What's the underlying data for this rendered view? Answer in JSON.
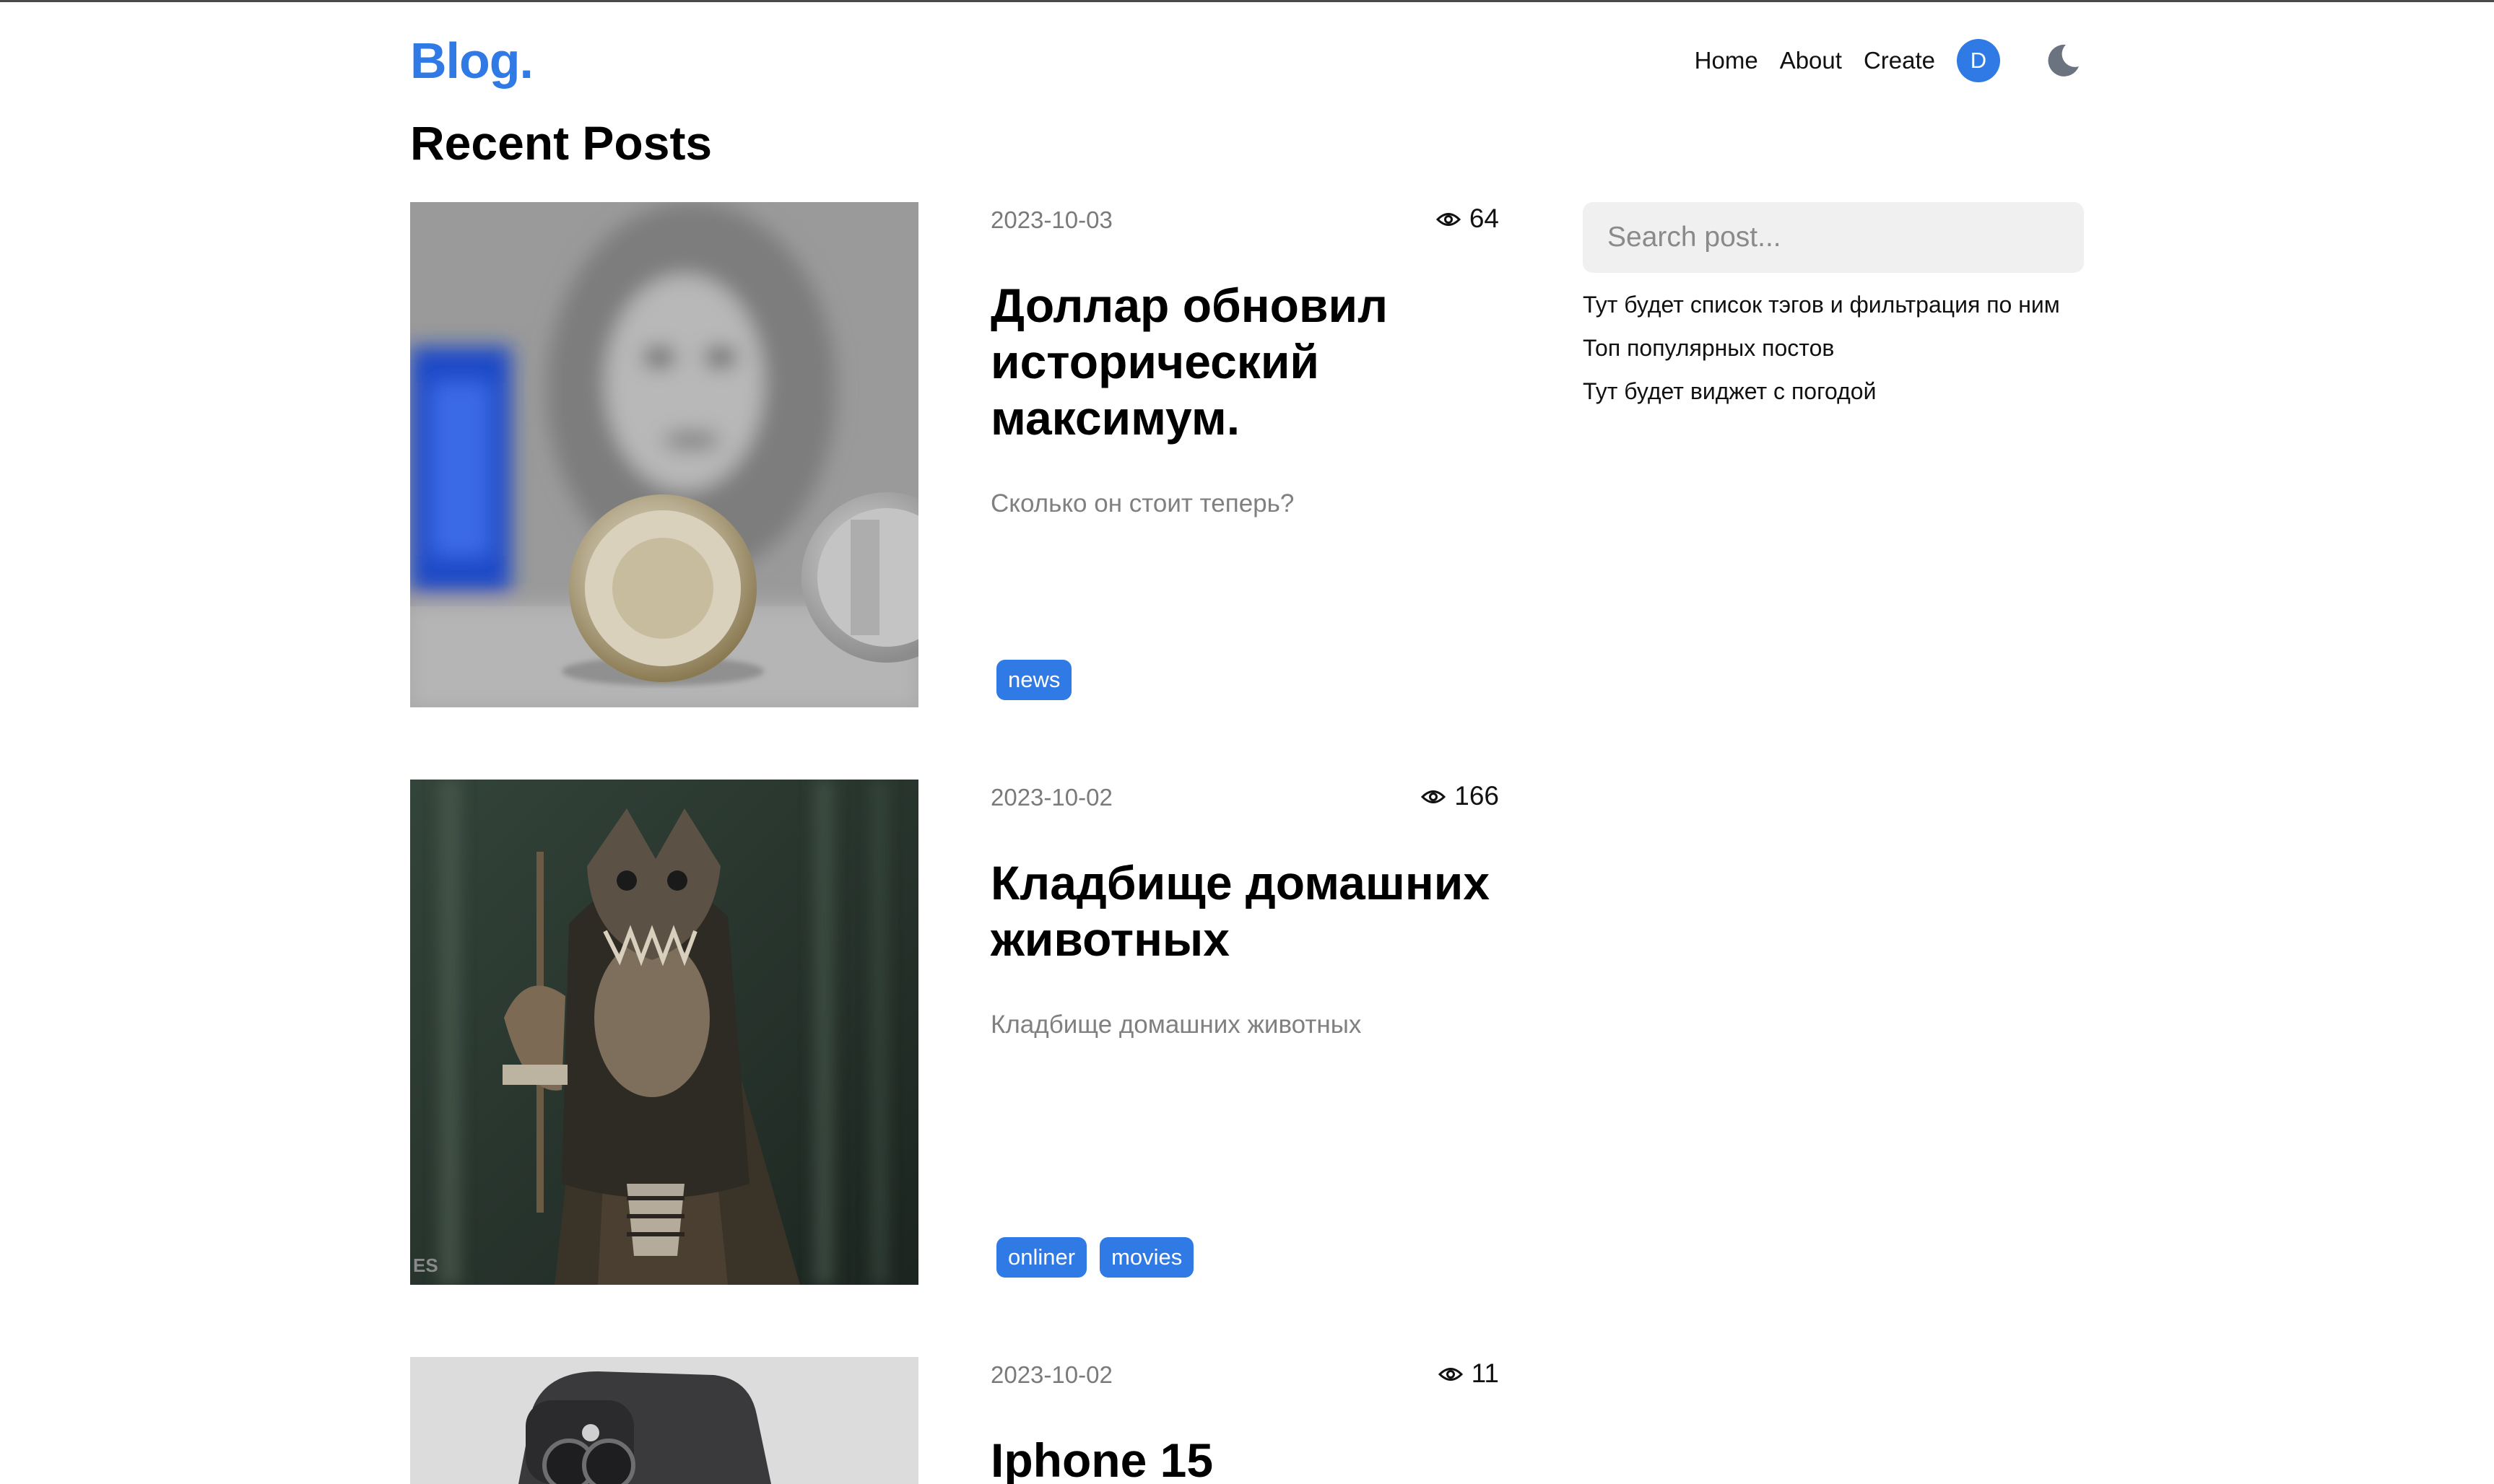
{
  "header": {
    "logo": "Blog.",
    "nav": [
      "Home",
      "About",
      "Create"
    ],
    "avatar_letter": "D",
    "theme_icon": "moon-icon"
  },
  "page_title": "Recent Posts",
  "posts": [
    {
      "date": "2023-10-03",
      "views": "64",
      "title": "Доллар обновил исторический максимум.",
      "description": "Сколько он стоит теперь?",
      "tags": [
        "news"
      ]
    },
    {
      "date": "2023-10-02",
      "views": "166",
      "title": "Кладбище домашних животных",
      "description": "Кладбище домашних животных",
      "tags": [
        "onliner",
        "movies"
      ],
      "image_caption": "ES"
    },
    {
      "date": "2023-10-02",
      "views": "11",
      "title": "Iphone 15"
    }
  ],
  "sidebar": {
    "search_placeholder": "Search post...",
    "items": [
      "Тут будет список тэгов и фильтрация по ним",
      "Топ популярных постов",
      "Тут будет виджет с погодой"
    ]
  },
  "colors": {
    "accent": "#2f7ae5",
    "muted_text": "#808080",
    "search_bg": "#f0f0f0"
  }
}
